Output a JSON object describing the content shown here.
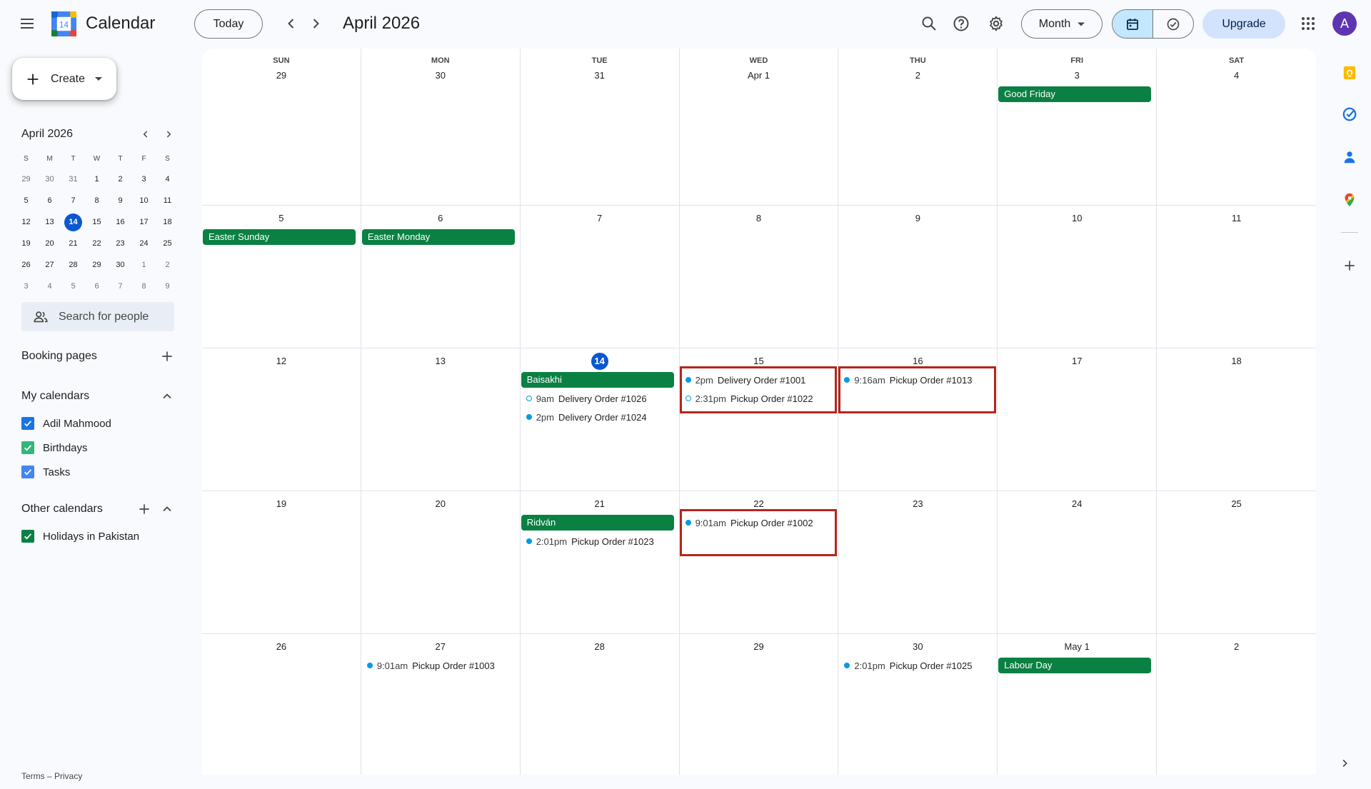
{
  "app": {
    "title": "Calendar",
    "logo_day": "14"
  },
  "header": {
    "today_label": "Today",
    "period_title": "April 2026",
    "view_select": "Month",
    "upgrade_label": "Upgrade",
    "avatar_letter": "A"
  },
  "sidebar": {
    "create_label": "Create",
    "mini_calendar": {
      "title": "April 2026",
      "dow": [
        "S",
        "M",
        "T",
        "W",
        "T",
        "F",
        "S"
      ],
      "weeks": [
        [
          "29",
          "30",
          "31",
          "1",
          "2",
          "3",
          "4"
        ],
        [
          "5",
          "6",
          "7",
          "8",
          "9",
          "10",
          "11"
        ],
        [
          "12",
          "13",
          "14",
          "15",
          "16",
          "17",
          "18"
        ],
        [
          "19",
          "20",
          "21",
          "22",
          "23",
          "24",
          "25"
        ],
        [
          "26",
          "27",
          "28",
          "29",
          "30",
          "1",
          "2"
        ],
        [
          "3",
          "4",
          "5",
          "6",
          "7",
          "8",
          "9"
        ]
      ],
      "today": "14"
    },
    "search_people_placeholder": "Search for people",
    "booking_pages_label": "Booking pages",
    "my_calendars_label": "My calendars",
    "my_calendars": [
      {
        "name": "Adil Mahmood",
        "color": "#1a73e8"
      },
      {
        "name": "Birthdays",
        "color": "#33b679"
      },
      {
        "name": "Tasks",
        "color": "#4285f4"
      }
    ],
    "other_calendars_label": "Other calendars",
    "other_calendars": [
      {
        "name": "Holidays in Pakistan",
        "color": "#0b8043"
      }
    ],
    "footer": "Terms – Privacy"
  },
  "month": {
    "dow": [
      "SUN",
      "MON",
      "TUE",
      "WED",
      "THU",
      "FRI",
      "SAT"
    ],
    "weeks": [
      {
        "days": [
          {
            "label": "29"
          },
          {
            "label": "30"
          },
          {
            "label": "31"
          },
          {
            "label": "Apr 1"
          },
          {
            "label": "2"
          },
          {
            "label": "3",
            "allday": "Good Friday"
          },
          {
            "label": "4"
          }
        ]
      },
      {
        "days": [
          {
            "label": "5",
            "allday": "Easter Sunday"
          },
          {
            "label": "6",
            "allday": "Easter Monday"
          },
          {
            "label": "7"
          },
          {
            "label": "8"
          },
          {
            "label": "9"
          },
          {
            "label": "10"
          },
          {
            "label": "11"
          }
        ]
      },
      {
        "days": [
          {
            "label": "12"
          },
          {
            "label": "13"
          },
          {
            "label": "14",
            "today": true,
            "allday": "Baisakhi",
            "events": [
              {
                "time": "9am",
                "title": "Delivery Order #1026",
                "hollow": true
              },
              {
                "time": "2pm",
                "title": "Delivery Order #1024"
              }
            ]
          },
          {
            "label": "15",
            "highlight": true,
            "events": [
              {
                "time": "2pm",
                "title": "Delivery Order #1001"
              },
              {
                "time": "2:31pm",
                "title": "Pickup Order #1022",
                "hollow": true
              }
            ]
          },
          {
            "label": "16",
            "highlight": true,
            "events": [
              {
                "time": "9:16am",
                "title": "Pickup Order #1013"
              }
            ]
          },
          {
            "label": "17"
          },
          {
            "label": "18"
          }
        ]
      },
      {
        "days": [
          {
            "label": "19"
          },
          {
            "label": "20"
          },
          {
            "label": "21",
            "allday": "Ridván",
            "events": [
              {
                "time": "2:01pm",
                "title": "Pickup Order #1023"
              }
            ]
          },
          {
            "label": "22",
            "highlight": true,
            "events": [
              {
                "time": "9:01am",
                "title": "Pickup Order #1002"
              }
            ]
          },
          {
            "label": "23"
          },
          {
            "label": "24"
          },
          {
            "label": "25"
          }
        ]
      },
      {
        "days": [
          {
            "label": "26"
          },
          {
            "label": "27",
            "events": [
              {
                "time": "9:01am",
                "title": "Pickup Order #1003"
              }
            ]
          },
          {
            "label": "28"
          },
          {
            "label": "29"
          },
          {
            "label": "30",
            "events": [
              {
                "time": "2:01pm",
                "title": "Pickup Order #1025"
              }
            ]
          },
          {
            "label": "May 1",
            "allday": "Labour Day"
          },
          {
            "label": "2"
          }
        ]
      }
    ]
  },
  "colors": {
    "holiday": "#0b8043",
    "event_dot": "#039be5",
    "today": "#0b57d0",
    "highlight_box": "#b3261e"
  },
  "right_rail": [
    "keep-icon",
    "tasks-icon",
    "contacts-icon",
    "maps-icon",
    "add-addon-icon"
  ]
}
